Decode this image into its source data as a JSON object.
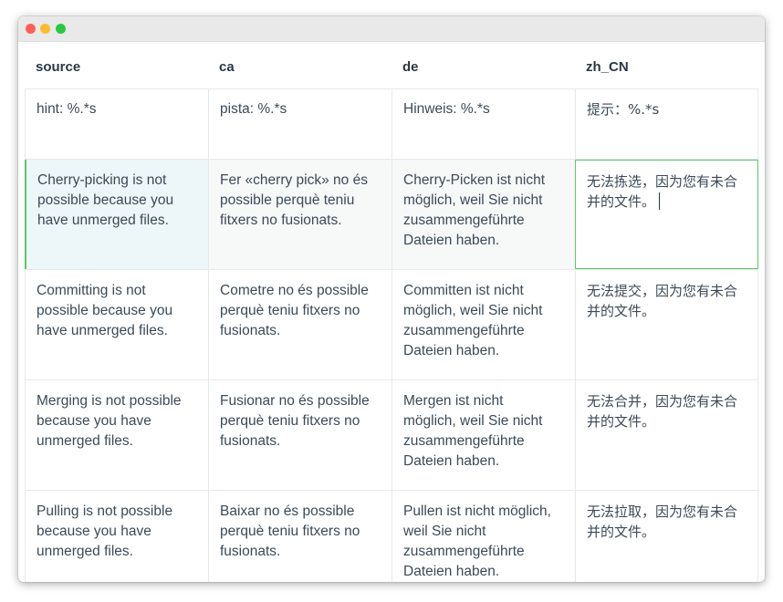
{
  "headers": [
    "source",
    "ca",
    "de",
    "zh_CN"
  ],
  "rows": [
    {
      "source": "hint: %.*s",
      "ca": "pista: %.*s",
      "de": "Hinweis: %.*s",
      "zh_CN": "提示：%.*s"
    },
    {
      "source": "Cherry-picking is not\npossible because you\nhave unmerged files.",
      "ca": "Fer «cherry pick» no és\npossible perquè teniu\nfitxers no fusionats.",
      "de": "Cherry-Picken ist nicht\nmöglich, weil Sie nicht\nzusammengeführte\nDateien haben.",
      "zh_CN": "无法拣选，因为您有未合\n并的文件。"
    },
    {
      "source": "Committing is not\npossible because you\nhave unmerged files.",
      "ca": "Cometre no és possible\nperquè teniu fitxers no\nfusionats.",
      "de": "Committen ist nicht\nmöglich, weil Sie nicht\nzusammengeführte\nDateien haben.",
      "zh_CN": "无法提交，因为您有未合\n并的文件。"
    },
    {
      "source": "Merging is not possible\nbecause you have\nunmerged files.",
      "ca": "Fusionar no és possible\nperquè teniu fitxers no\nfusionats.",
      "de": "Mergen ist nicht\nmöglich, weil Sie nicht\nzusammengeführte\nDateien haben.",
      "zh_CN": "无法合并，因为您有未合\n并的文件。"
    },
    {
      "source": "Pulling is not possible\nbecause you have\nunmerged files.",
      "ca": "Baixar no és possible\nperquè teniu fitxers no\nfusionats.",
      "de": "Pullen ist nicht möglich,\nweil Sie nicht\nzusammengeführte\nDateien haben.",
      "zh_CN": "无法拉取，因为您有未合\n并的文件。"
    }
  ],
  "colors": {
    "accent_green": "#5cc66a",
    "active_row_bg": "#edf6f8",
    "text": "#3c4a57"
  }
}
